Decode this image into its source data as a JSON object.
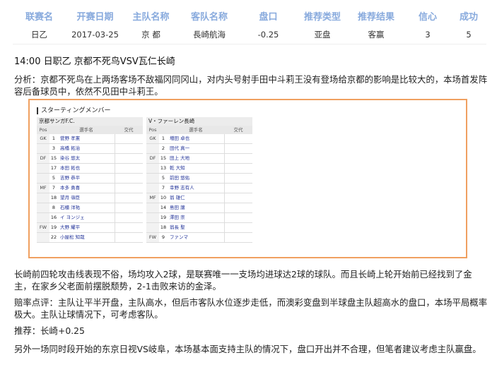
{
  "summary": {
    "headers": [
      "联赛名",
      "开赛日期",
      "主队名称",
      "客队名称",
      "盘口",
      "推荐类型",
      "推荐结果",
      "信心",
      "成功"
    ],
    "values": [
      "日乙",
      "2017-03-25",
      "京 都",
      "長崎航海",
      "-0.25",
      "亚盘",
      "客赢",
      "3",
      "5"
    ]
  },
  "match_title": "14:00 日职乙 京都不死鸟VSV瓦仁长崎",
  "paragraphs": {
    "analysis": "分析：京都不死鸟在上两场客场不敌福冈同冈山，对内头号射手田中斗莉王没有登场给京都的影响是比较大的，本场首发阵容后备球员中，依然不见田中斗莉王。",
    "nagasaki": "长崎前四轮攻击线表现不俗，场均攻入2球，是联赛唯一一支场均进球达2球的球队。而且长崎上轮开始前已经找到了金主，在家乡父老面前摆脱颓势，2-1击败来访的金泽。",
    "odds": "赔率点评：主队让平半开盘，主队高水，但后市客队水位逐步走低，而澳彩变盘到半球盘主队超高水的盘口，本场平局概率极大。主队让球情况下，可考虑客队。",
    "recommend": "推荐：长崎+0.25",
    "other": "另外一场同时段开始的东京日视VS岐阜，本场基本面支持主队的情况下，盘口开出并不合理，但笔者建议考虑主队赢盘。"
  },
  "lineup": {
    "title": "スターティングメンバー",
    "columns": [
      "Pos",
      "",
      "選手名",
      "交代"
    ],
    "home": {
      "team": "京都サンガF.C.",
      "rows": [
        {
          "pos": "GK",
          "num": "1",
          "name": "菅野 孝憲"
        },
        {
          "pos": "",
          "num": "3",
          "name": "高橋 拓治"
        },
        {
          "pos": "DF",
          "num": "15",
          "name": "染谷 悠太"
        },
        {
          "pos": "",
          "num": "17",
          "name": "本田 拓也"
        },
        {
          "pos": "",
          "num": "5",
          "name": "吉野 恭平"
        },
        {
          "pos": "MF",
          "num": "7",
          "name": "本多 勇喜"
        },
        {
          "pos": "",
          "num": "18",
          "name": "望月 嶺臣"
        },
        {
          "pos": "",
          "num": "8",
          "name": "石櫃 洋祐"
        },
        {
          "pos": "",
          "num": "16",
          "name": "イ ヨンジェ"
        },
        {
          "pos": "FW",
          "num": "19",
          "name": "大野 耀平"
        },
        {
          "pos": "",
          "num": "22",
          "name": "小屋松 知哉"
        }
      ]
    },
    "away": {
      "team": "V・ファーレン長崎",
      "rows": [
        {
          "pos": "GK",
          "num": "1",
          "name": "増田 卓也"
        },
        {
          "pos": "",
          "num": "2",
          "name": "田代 真一"
        },
        {
          "pos": "DF",
          "num": "15",
          "name": "田上 大地"
        },
        {
          "pos": "",
          "num": "13",
          "name": "乾 大知"
        },
        {
          "pos": "",
          "num": "5",
          "name": "前田 悠佑"
        },
        {
          "pos": "",
          "num": "7",
          "name": "幸野 志有人"
        },
        {
          "pos": "MF",
          "num": "10",
          "name": "翁 雄仁"
        },
        {
          "pos": "",
          "num": "14",
          "name": "島田 譲"
        },
        {
          "pos": "",
          "num": "19",
          "name": "澤田 崇"
        },
        {
          "pos": "",
          "num": "18",
          "name": "翁長 聖"
        },
        {
          "pos": "FW",
          "num": "9",
          "name": "ファンマ"
        }
      ]
    }
  }
}
